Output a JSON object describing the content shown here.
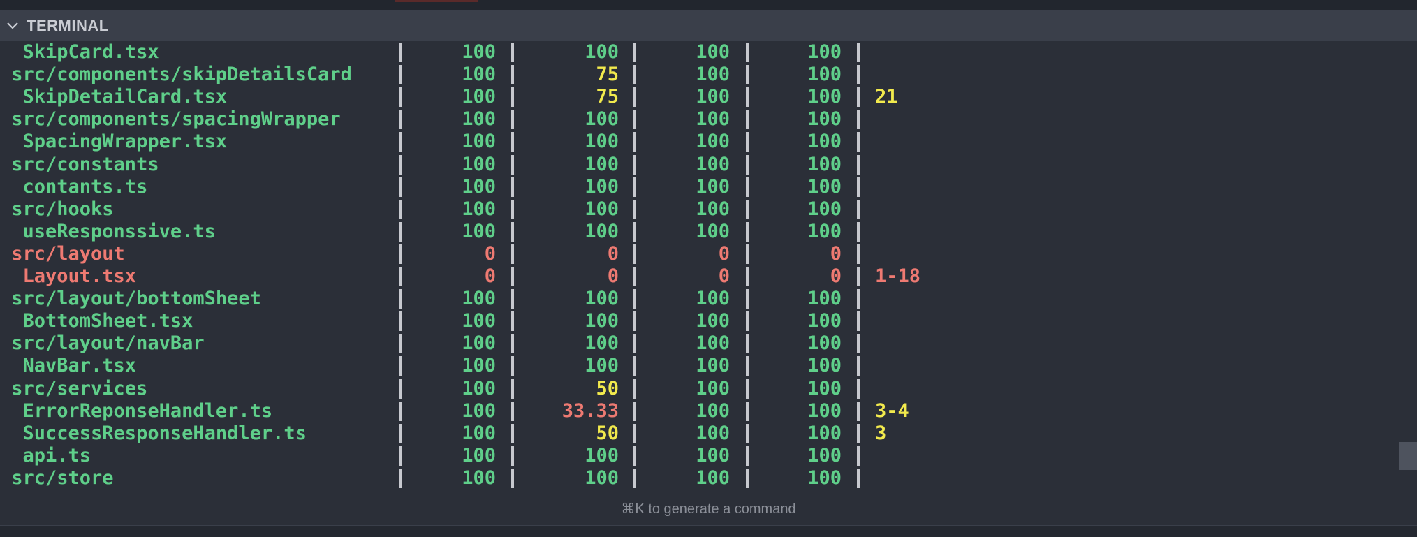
{
  "panel": {
    "title": "TERMINAL"
  },
  "colors": {
    "green": "#5fcf8a",
    "yellow": "#f2ea4d",
    "red": "#ee7a72"
  },
  "coverage_rows": [
    {
      "file": "  SkipCard.tsx",
      "stmts": "100",
      "branch": "100",
      "funcs": "100",
      "lines": "100",
      "uncovered": "",
      "colors": [
        "green",
        "green",
        "green",
        "green",
        "green",
        "green"
      ]
    },
    {
      "file": " src/components/skipDetailsCard",
      "stmts": "100",
      "branch": "75",
      "funcs": "100",
      "lines": "100",
      "uncovered": "",
      "colors": [
        "green",
        "green",
        "yellow",
        "green",
        "green",
        "green"
      ]
    },
    {
      "file": "  SkipDetailCard.tsx",
      "stmts": "100",
      "branch": "75",
      "funcs": "100",
      "lines": "100",
      "uncovered": "21",
      "colors": [
        "green",
        "green",
        "yellow",
        "green",
        "green",
        "yellow"
      ]
    },
    {
      "file": " src/components/spacingWrapper",
      "stmts": "100",
      "branch": "100",
      "funcs": "100",
      "lines": "100",
      "uncovered": "",
      "colors": [
        "green",
        "green",
        "green",
        "green",
        "green",
        "green"
      ]
    },
    {
      "file": "  SpacingWrapper.tsx",
      "stmts": "100",
      "branch": "100",
      "funcs": "100",
      "lines": "100",
      "uncovered": "",
      "colors": [
        "green",
        "green",
        "green",
        "green",
        "green",
        "green"
      ]
    },
    {
      "file": " src/constants",
      "stmts": "100",
      "branch": "100",
      "funcs": "100",
      "lines": "100",
      "uncovered": "",
      "colors": [
        "green",
        "green",
        "green",
        "green",
        "green",
        "green"
      ]
    },
    {
      "file": "  contants.ts",
      "stmts": "100",
      "branch": "100",
      "funcs": "100",
      "lines": "100",
      "uncovered": "",
      "colors": [
        "green",
        "green",
        "green",
        "green",
        "green",
        "green"
      ]
    },
    {
      "file": " src/hooks",
      "stmts": "100",
      "branch": "100",
      "funcs": "100",
      "lines": "100",
      "uncovered": "",
      "colors": [
        "green",
        "green",
        "green",
        "green",
        "green",
        "green"
      ]
    },
    {
      "file": "  useResponssive.ts",
      "stmts": "100",
      "branch": "100",
      "funcs": "100",
      "lines": "100",
      "uncovered": "",
      "colors": [
        "green",
        "green",
        "green",
        "green",
        "green",
        "green"
      ]
    },
    {
      "file": " src/layout",
      "stmts": "0",
      "branch": "0",
      "funcs": "0",
      "lines": "0",
      "uncovered": "",
      "colors": [
        "red",
        "red",
        "red",
        "red",
        "red",
        "red"
      ]
    },
    {
      "file": "  Layout.tsx",
      "stmts": "0",
      "branch": "0",
      "funcs": "0",
      "lines": "0",
      "uncovered": "1-18",
      "colors": [
        "red",
        "red",
        "red",
        "red",
        "red",
        "red"
      ]
    },
    {
      "file": " src/layout/bottomSheet",
      "stmts": "100",
      "branch": "100",
      "funcs": "100",
      "lines": "100",
      "uncovered": "",
      "colors": [
        "green",
        "green",
        "green",
        "green",
        "green",
        "green"
      ]
    },
    {
      "file": "  BottomSheet.tsx",
      "stmts": "100",
      "branch": "100",
      "funcs": "100",
      "lines": "100",
      "uncovered": "",
      "colors": [
        "green",
        "green",
        "green",
        "green",
        "green",
        "green"
      ]
    },
    {
      "file": " src/layout/navBar",
      "stmts": "100",
      "branch": "100",
      "funcs": "100",
      "lines": "100",
      "uncovered": "",
      "colors": [
        "green",
        "green",
        "green",
        "green",
        "green",
        "green"
      ]
    },
    {
      "file": "  NavBar.tsx",
      "stmts": "100",
      "branch": "100",
      "funcs": "100",
      "lines": "100",
      "uncovered": "",
      "colors": [
        "green",
        "green",
        "green",
        "green",
        "green",
        "green"
      ]
    },
    {
      "file": " src/services",
      "stmts": "100",
      "branch": "50",
      "funcs": "100",
      "lines": "100",
      "uncovered": "",
      "colors": [
        "green",
        "green",
        "yellow",
        "green",
        "green",
        "green"
      ]
    },
    {
      "file": "  ErrorReponseHandler.ts",
      "stmts": "100",
      "branch": "33.33",
      "funcs": "100",
      "lines": "100",
      "uncovered": "3-4",
      "colors": [
        "green",
        "green",
        "red",
        "green",
        "green",
        "yellow"
      ]
    },
    {
      "file": "  SuccessResponseHandler.ts",
      "stmts": "100",
      "branch": "50",
      "funcs": "100",
      "lines": "100",
      "uncovered": "3",
      "colors": [
        "green",
        "green",
        "yellow",
        "green",
        "green",
        "yellow"
      ]
    },
    {
      "file": "  api.ts",
      "stmts": "100",
      "branch": "100",
      "funcs": "100",
      "lines": "100",
      "uncovered": "",
      "colors": [
        "green",
        "green",
        "green",
        "green",
        "green",
        "green"
      ]
    },
    {
      "file": " src/store",
      "stmts": "100",
      "branch": "100",
      "funcs": "100",
      "lines": "100",
      "uncovered": "",
      "colors": [
        "green",
        "green",
        "green",
        "green",
        "green",
        "green"
      ]
    }
  ],
  "prompt_hint": "⌘K to generate a command",
  "icons": {
    "collapse": "chevron-down-icon"
  }
}
